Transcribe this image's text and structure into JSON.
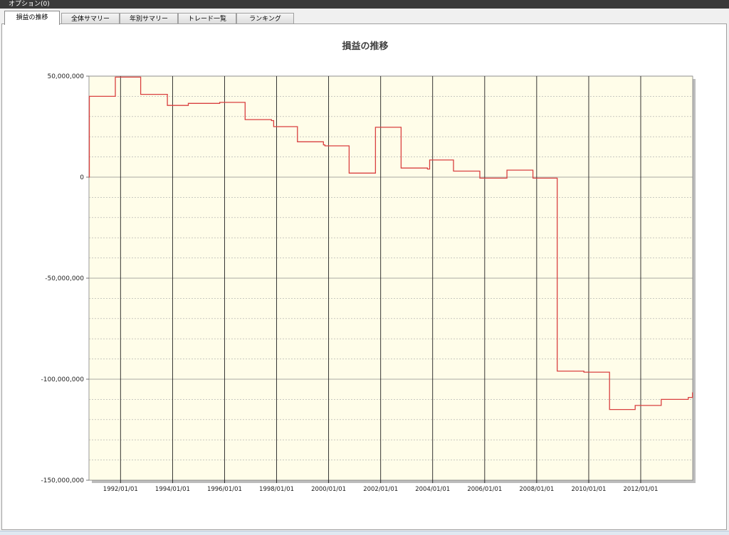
{
  "window": {
    "menu_label": "オプション(0)"
  },
  "tabs": [
    {
      "label": "損益の推移",
      "active": true
    },
    {
      "label": "全体サマリー",
      "active": false
    },
    {
      "label": "年別サマリー",
      "active": false
    },
    {
      "label": "トレード一覧",
      "active": false
    },
    {
      "label": "ランキング",
      "active": false
    }
  ],
  "colors": {
    "plot_bg": "#fffde9",
    "line": "#d94040",
    "grid": "#9a9a9a"
  },
  "chart_data": {
    "type": "line",
    "title": "損益の推移",
    "xlabel": "",
    "ylabel": "",
    "grid": true,
    "xlim": [
      "1990-10-15",
      "2013-12-31"
    ],
    "ylim": [
      -150000000,
      50000000
    ],
    "y_ticks": [
      50000000,
      0,
      -50000000,
      -100000000,
      -150000000
    ],
    "y_tick_labels": [
      "50,000,000",
      "0",
      "-50,000,000",
      "-100,000,000",
      "-150,000,000"
    ],
    "x_ticks": [
      "1992-01-01",
      "1994-01-01",
      "1996-01-01",
      "1998-01-01",
      "2000-01-01",
      "2002-01-01",
      "2004-01-01",
      "2006-01-01",
      "2008-01-01",
      "2010-01-01",
      "2012-01-01"
    ],
    "x_tick_labels": [
      "1992/01/01",
      "1994/01/01",
      "1996/01/01",
      "1998/01/01",
      "2000/01/01",
      "2002/01/01",
      "2004/01/01",
      "2006/01/01",
      "2008/01/01",
      "2010/01/01",
      "2012/01/01"
    ],
    "series": [
      {
        "step": true,
        "x": [
          "1990-10-15",
          "1990-10-20",
          "1991-10-20",
          "1992-10-10",
          "1993-10-20",
          "1994-08-10",
          "1995-10-25",
          "1996-10-15",
          "1997-10-20",
          "1997-11-20",
          "1998-10-20",
          "1999-10-20",
          "1999-11-10",
          "2000-10-15",
          "2001-10-20",
          "2002-10-15",
          "2003-10-20",
          "2003-11-20",
          "2004-10-20",
          "2005-10-25",
          "2006-11-10",
          "2007-11-10",
          "2008-10-15",
          "2009-10-25",
          "2010-10-20",
          "2011-10-15",
          "2012-10-15",
          "2013-10-30",
          "2013-12-28"
        ],
        "values": [
          0,
          40000000,
          49500000,
          41000000,
          35500000,
          36500000,
          37000000,
          28500000,
          28000000,
          25000000,
          17500000,
          16000000,
          15500000,
          2000000,
          24700000,
          4500000,
          4000000,
          8500000,
          3000000,
          -500000,
          3500000,
          -500000,
          -96000000,
          -96500000,
          -115000000,
          -113000000,
          -110000000,
          -109000000,
          -106500000
        ]
      }
    ]
  }
}
